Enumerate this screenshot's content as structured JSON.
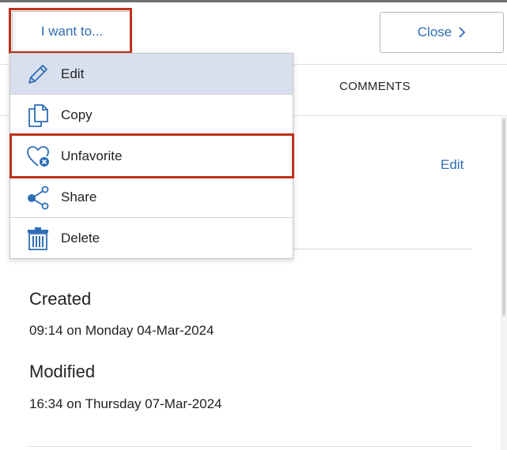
{
  "header": {
    "iwant_label": "I want to...",
    "close_label": "Close"
  },
  "tabs": {
    "comments_label": "COMMENTS"
  },
  "menu": {
    "items": [
      {
        "label": "Edit",
        "icon": "pencil-icon"
      },
      {
        "label": "Copy",
        "icon": "copy-icon"
      },
      {
        "label": "Unfavorite",
        "icon": "heart-remove-icon"
      },
      {
        "label": "Share",
        "icon": "share-icon"
      },
      {
        "label": "Delete",
        "icon": "trash-icon"
      }
    ]
  },
  "details": {
    "edit_link": "Edit",
    "created_label": "Created",
    "created_value": "09:14 on Monday 04-Mar-2024",
    "modified_label": "Modified",
    "modified_value": "16:34 on Thursday 07-Mar-2024"
  },
  "colors": {
    "accent": "#2f6db5",
    "highlight": "#c0311a",
    "selected_row": "#d8e0ef"
  }
}
